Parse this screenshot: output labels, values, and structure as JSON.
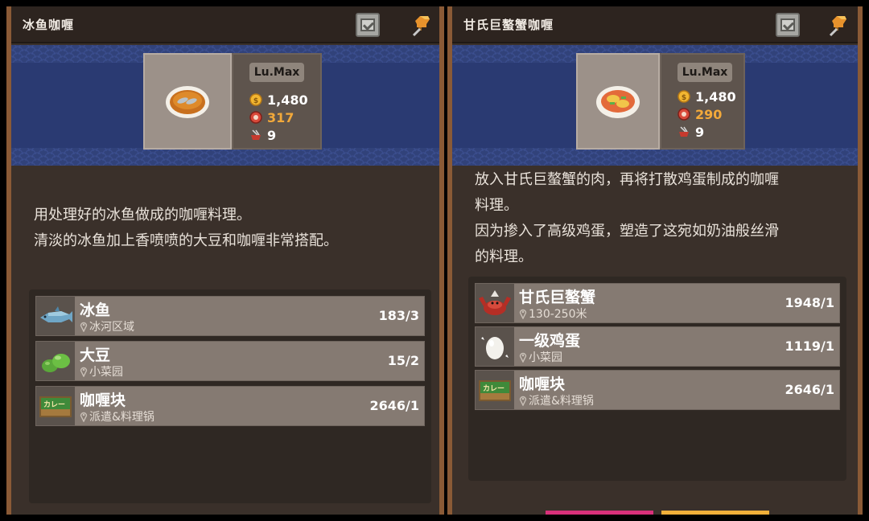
{
  "panels": [
    {
      "title": "冰鱼咖喱",
      "level": "Lu.Max",
      "price": "1,480",
      "affinity": "317",
      "count": "9",
      "description": [
        "用处理好的冰鱼做成的咖喱料理。",
        "清淡的冰鱼加上香喷喷的大豆和咖喱非常搭配。"
      ],
      "ingredients": [
        {
          "name": "冰鱼",
          "location": "冰河区域",
          "count": "183/3",
          "icon": "ice-fish-icon"
        },
        {
          "name": "大豆",
          "location": "小菜园",
          "count": "15/2",
          "icon": "soybean-icon"
        },
        {
          "name": "咖喱块",
          "location": "派遣&料理锅",
          "count": "2646/1",
          "icon": "curry-block-icon"
        }
      ]
    },
    {
      "title": "甘氏巨螯蟹咖喱",
      "level": "Lu.Max",
      "price": "1,480",
      "affinity": "290",
      "count": "9",
      "description": [
        "放入甘氏巨螯蟹的肉，再将打散鸡蛋制成的咖喱",
        "料理。",
        "因为掺入了高级鸡蛋，塑造了这宛如奶油般丝滑",
        "的料理。"
      ],
      "ingredients": [
        {
          "name": "甘氏巨螯蟹",
          "location": "130-250米",
          "count": "1948/1",
          "icon": "giant-crab-icon"
        },
        {
          "name": "一级鸡蛋",
          "location": "小菜园",
          "count": "1119/1",
          "icon": "egg-icon"
        },
        {
          "name": "咖喱块",
          "location": "派遣&料理锅",
          "count": "2646/1",
          "icon": "curry-block-icon"
        }
      ]
    }
  ],
  "colors": {
    "price": "#ffffff",
    "affinity": "#f2a93a",
    "count": "#ffffff",
    "accent_pink": "#d8307a",
    "accent_yellow": "#f0b03a"
  }
}
